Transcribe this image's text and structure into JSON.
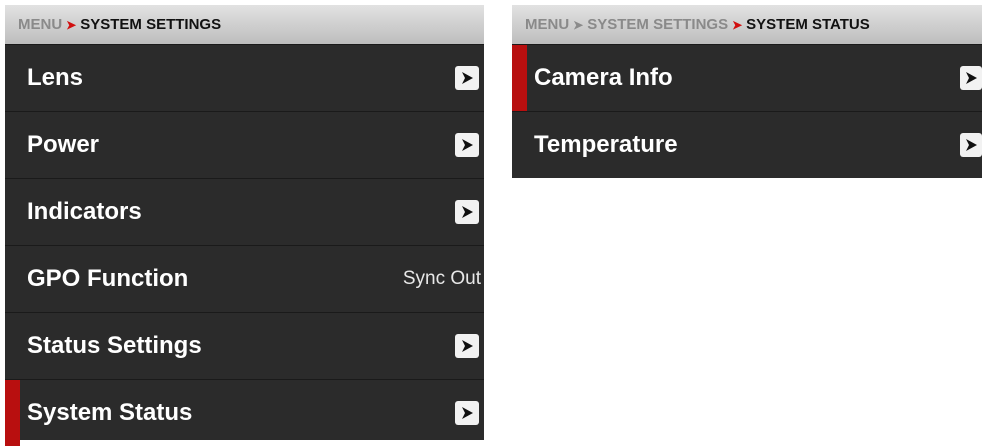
{
  "left_panel": {
    "breadcrumb": [
      "MENU",
      "SYSTEM SETTINGS"
    ],
    "items": [
      {
        "label": "Lens",
        "type": "submenu",
        "selected": false
      },
      {
        "label": "Power",
        "type": "submenu",
        "selected": false
      },
      {
        "label": "Indicators",
        "type": "submenu",
        "selected": false
      },
      {
        "label": "GPO Function",
        "type": "value",
        "value": "Sync Out",
        "selected": false
      },
      {
        "label": "Status Settings",
        "type": "submenu",
        "selected": false
      },
      {
        "label": "System Status",
        "type": "submenu",
        "selected": true
      }
    ]
  },
  "right_panel": {
    "breadcrumb": [
      "MENU",
      "SYSTEM SETTINGS",
      "SYSTEM STATUS"
    ],
    "items": [
      {
        "label": "Camera Info",
        "type": "submenu",
        "selected": true
      },
      {
        "label": "Temperature",
        "type": "submenu",
        "selected": false
      }
    ]
  },
  "colors": {
    "accent": "#d10f0f",
    "selection": "#b80f0f",
    "row_bg": "#2b2b2b"
  },
  "icons": {
    "submenu": "chevron-right-icon"
  }
}
